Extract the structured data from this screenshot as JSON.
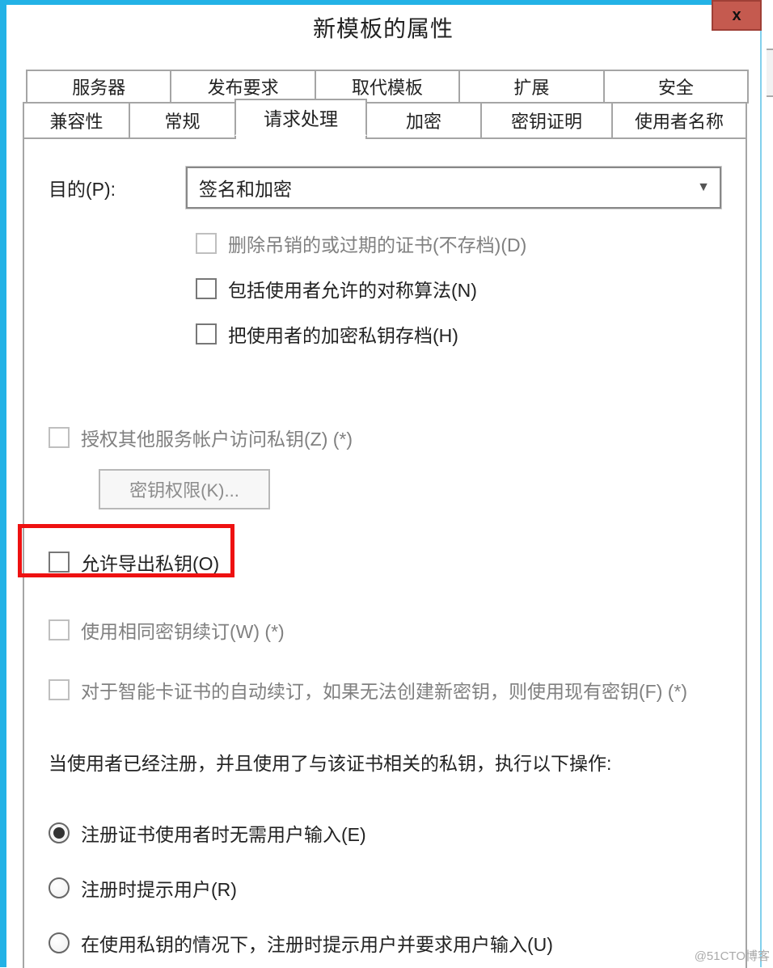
{
  "window": {
    "title": "新模板的属性",
    "close": "x"
  },
  "tabs_row1": {
    "t1": "服务器",
    "t2": "发布要求",
    "t3": "取代模板",
    "t4": "扩展",
    "t5": "安全"
  },
  "tabs_row2": {
    "t1": "兼容性",
    "t2": "常规",
    "t3": "请求处理",
    "t4": "加密",
    "t5": "密钥证明",
    "t6": "使用者名称"
  },
  "purpose": {
    "label": "目的(P):",
    "value": "签名和加密"
  },
  "checks": {
    "del_revoked": "删除吊销的或过期的证书(不存档)(D)",
    "include_sym": "包括使用者允许的对称算法(N)",
    "archive_key": "把使用者的加密私钥存档(H)",
    "auth_service": "授权其他服务帐户访问私钥(Z) (*)",
    "allow_export": "允许导出私钥(O)",
    "renew_same": "使用相同密钥续订(W) (*)",
    "smartcard": "对于智能卡证书的自动续订，如果无法创建新密钥，则使用现有密钥(F) (*)"
  },
  "buttons": {
    "key_perm": "密钥权限(K)..."
  },
  "section_text": "当使用者已经注册，并且使用了与该证书相关的私钥，执行以下操作:",
  "radios": {
    "r1": "注册证书使用者时无需用户输入(E)",
    "r2": "注册时提示用户(R)",
    "r3": "在使用私钥的情况下，注册时提示用户并要求用户输入(U)"
  },
  "watermark": "@51CTO博客"
}
